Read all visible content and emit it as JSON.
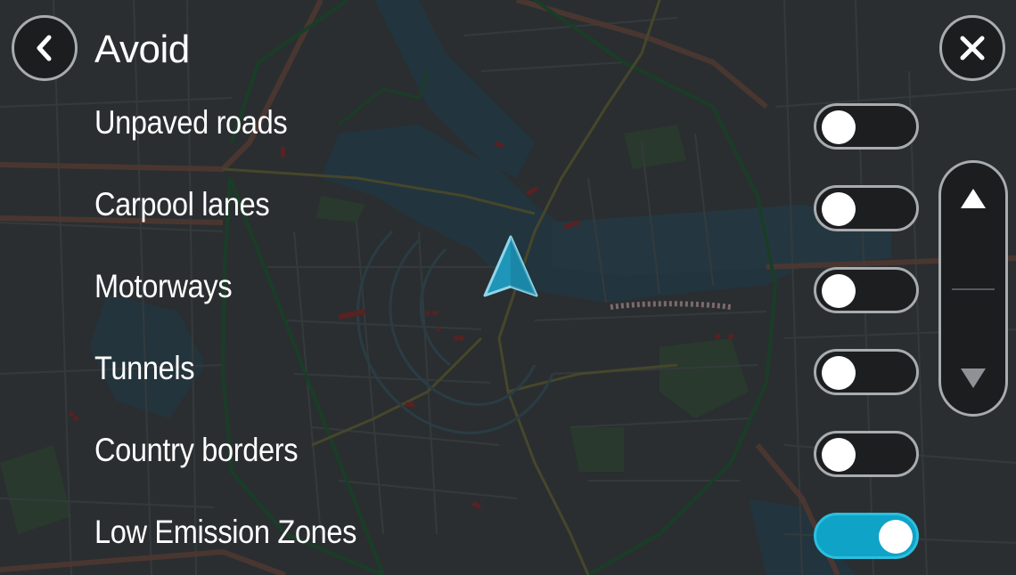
{
  "header": {
    "title": "Avoid"
  },
  "icons": {
    "back": "chevron-left-icon",
    "close": "close-icon",
    "scroll_up": "triangle-up-icon",
    "scroll_down": "triangle-down-icon",
    "position": "navigation-arrow-icon"
  },
  "options": [
    {
      "label": "Unpaved roads",
      "enabled": false
    },
    {
      "label": "Carpool lanes",
      "enabled": false
    },
    {
      "label": "Motorways",
      "enabled": false
    },
    {
      "label": "Tunnels",
      "enabled": false
    },
    {
      "label": "Country borders",
      "enabled": false
    },
    {
      "label": "Low Emission Zones",
      "enabled": true
    }
  ],
  "colors": {
    "toggle_on": "#0fa3c7",
    "toggle_off": "#1c1e20",
    "position_arrow": "#1a8fb0"
  }
}
